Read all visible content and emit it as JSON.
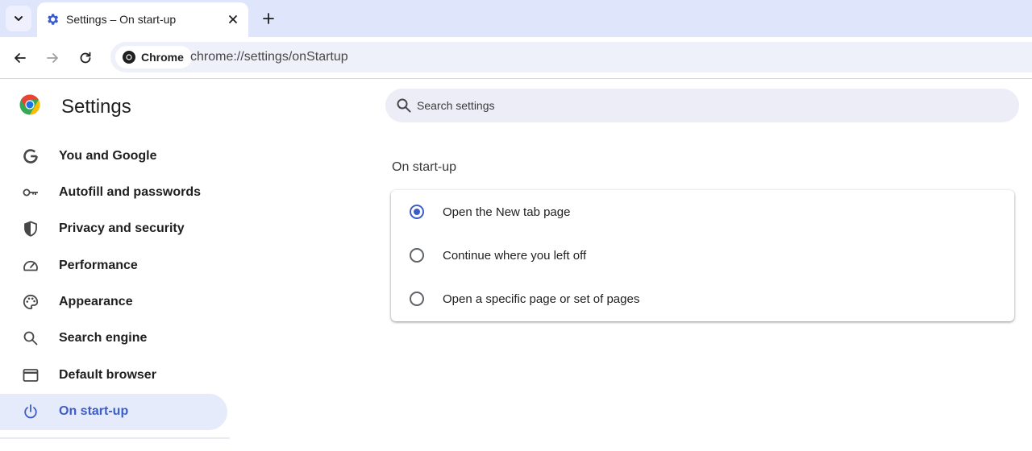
{
  "browser": {
    "tab": {
      "title": "Settings – On start-up"
    },
    "omnibox": {
      "chip_label": "Chrome",
      "url": "chrome://settings/onStartup"
    }
  },
  "settings": {
    "title": "Settings",
    "search": {
      "placeholder": "Search settings"
    },
    "sidebar": {
      "items": [
        {
          "label": "You and Google",
          "icon": "google-g-icon",
          "selected": false
        },
        {
          "label": "Autofill and passwords",
          "icon": "key-icon",
          "selected": false
        },
        {
          "label": "Privacy and security",
          "icon": "shield-icon",
          "selected": false
        },
        {
          "label": "Performance",
          "icon": "speedometer-icon",
          "selected": false
        },
        {
          "label": "Appearance",
          "icon": "palette-icon",
          "selected": false
        },
        {
          "label": "Search engine",
          "icon": "search-icon",
          "selected": false
        },
        {
          "label": "Default browser",
          "icon": "browser-window-icon",
          "selected": false
        },
        {
          "label": "On start-up",
          "icon": "power-icon",
          "selected": true
        }
      ]
    },
    "section": {
      "title": "On start-up",
      "options": [
        {
          "label": "Open the New tab page",
          "checked": true
        },
        {
          "label": "Continue where you left off",
          "checked": false
        },
        {
          "label": "Open a specific page or set of pages",
          "checked": false
        }
      ]
    }
  },
  "colors": {
    "accent": "#3c5dc9",
    "selected_bg": "#e5ebfb",
    "tabstrip_bg": "#dfe5fb"
  }
}
